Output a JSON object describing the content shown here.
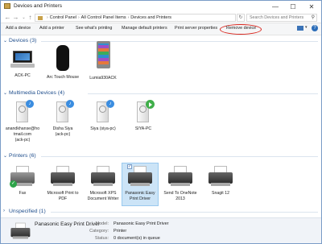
{
  "window": {
    "title": "Devices and Printers",
    "min": "—",
    "max": "☐",
    "close": "✕"
  },
  "address": {
    "back": "←",
    "forward": "→",
    "recent": "⌄",
    "up": "↑",
    "crumbs": [
      "Control Panel",
      "All Control Panel Items",
      "Devices and Printers"
    ],
    "separator": "›",
    "refresh": "↻",
    "search_placeholder": "Search Devices and Printers",
    "search_icon": "⚲"
  },
  "toolbar": {
    "add_device": "Add a device",
    "add_printer": "Add a printer",
    "see_printing": "See what's printing",
    "manage_default": "Manage default printers",
    "print_server": "Print server properties",
    "remove_device": "Remove device",
    "view_arrow": "▾",
    "help": "?"
  },
  "sections": {
    "devices": "Devices (3)",
    "multimedia": "Multimedia Devices (4)",
    "printers": "Printers (6)",
    "unspecified": "Unspecified (1)"
  },
  "devices": [
    "ACK-PC",
    "Arc Touch Mouse",
    "Lumia930ACK"
  ],
  "multimedia": [
    [
      "anandkhanse@ho",
      "tmail.com",
      "(ack-pc)"
    ],
    [
      "Disha Siya",
      "(ack-pc)"
    ],
    [
      "Siya (siya-pc)"
    ],
    [
      "SIYA-PC"
    ]
  ],
  "printers": [
    [
      "Fax"
    ],
    [
      "Microsoft Print to",
      "PDF"
    ],
    [
      "Microsoft XPS",
      "Document Writer"
    ],
    [
      "Panasonic Easy",
      "Print Driver"
    ],
    [
      "Send To OneNote",
      "2013"
    ],
    [
      "Snagit 12"
    ]
  ],
  "details": {
    "name": "Panasonic Easy Print Driver",
    "model_label": "Model:",
    "model": "Panasonic Easy Print Driver",
    "category_label": "Category:",
    "category": "Printer",
    "status_label": "Status:",
    "status": "0 document(s) in queue"
  },
  "colors": {
    "accent": "#1f4e8c",
    "highlight": "#d9251c",
    "selection": "#cce4f7"
  }
}
